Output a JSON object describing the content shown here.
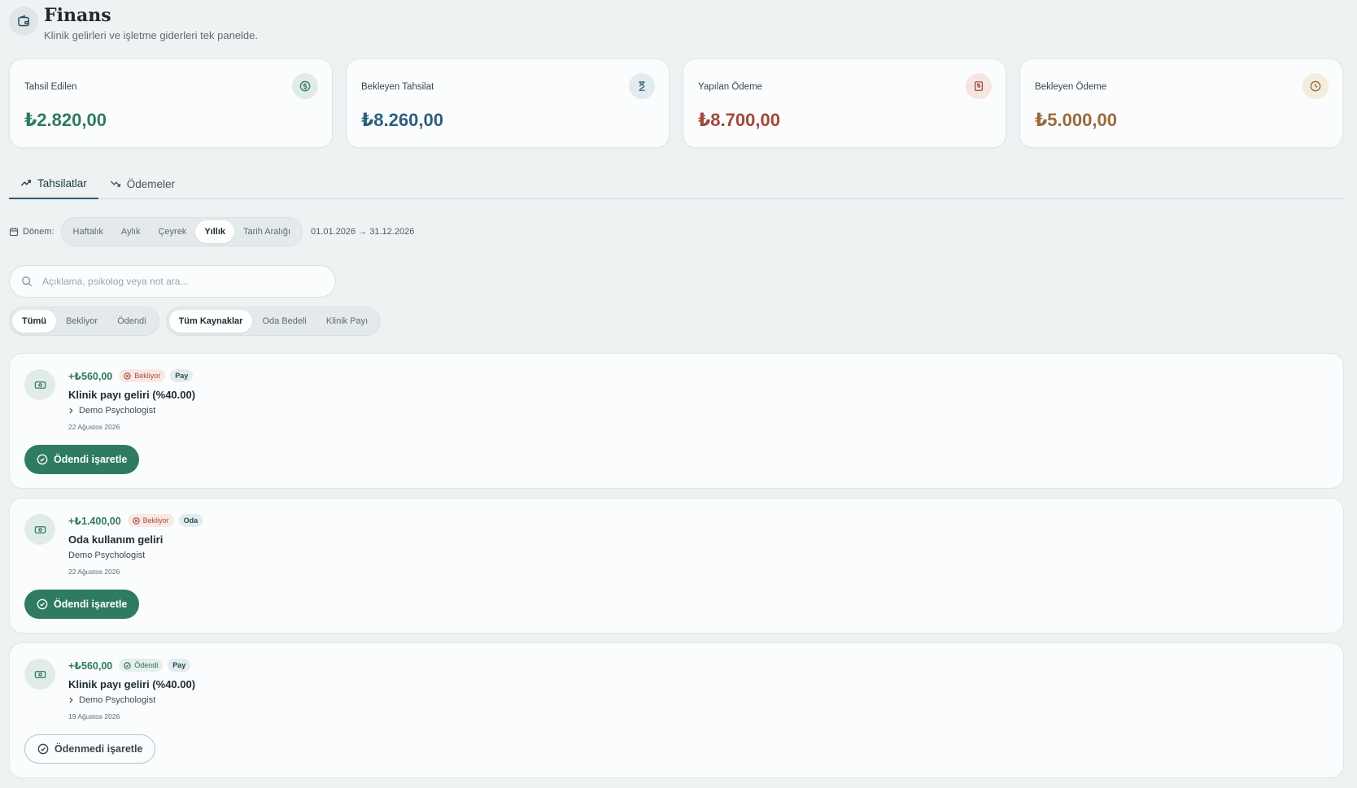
{
  "header": {
    "title": "Finans",
    "subtitle": "Klinik gelirleri ve işletme giderleri tek panelde.",
    "icon": "wallet-icon"
  },
  "stats": [
    {
      "label": "Tahsil Edilen",
      "value": "₺2.820,00",
      "color": "#2e7a62",
      "icon": "dollar-circle-icon",
      "icon_bg": "#e2ece7"
    },
    {
      "label": "Bekleyen Tahsilat",
      "value": "₺8.260,00",
      "color": "#2d5f7c",
      "icon": "hourglass-icon",
      "icon_bg": "#e3ebef"
    },
    {
      "label": "Yapılan Ödeme",
      "value": "₺8.700,00",
      "color": "#a3473a",
      "icon": "receipt-icon",
      "icon_bg": "#f6e6e2"
    },
    {
      "label": "Bekleyen Ödeme",
      "value": "₺5.000,00",
      "color": "#9a6a3a",
      "icon": "clock-icon",
      "icon_bg": "#f5ece0"
    }
  ],
  "tabs": {
    "collections": "Tahsilatlar",
    "payments": "Ödemeler"
  },
  "period": {
    "label": "Dönem:",
    "options": [
      "Haftalık",
      "Aylık",
      "Çeyrek",
      "Yıllık",
      "Tarih Aralığı"
    ],
    "selected": "Yıllık",
    "range": "01.01.2026 → 31.12.2026"
  },
  "search": {
    "placeholder": "Açıklama, psikolog veya not ara..."
  },
  "status_filter": {
    "options": [
      "Tümü",
      "Bekliyor",
      "Ödendi"
    ],
    "selected": "Tümü"
  },
  "source_filter": {
    "options": [
      "Tüm Kaynaklar",
      "Oda Bedeli",
      "Klinik Payı"
    ],
    "selected": "Tüm Kaynaklar"
  },
  "entries": [
    {
      "amount": "+₺560,00",
      "status": "Bekliyor",
      "source": "Pay",
      "title": "Klinik payı geliri (%40.00)",
      "person": "Demo Psychologist",
      "date": "22 Ağustos 2026",
      "action": "Ödendi işaretle"
    },
    {
      "amount": "+₺1.400,00",
      "status": "Bekliyor",
      "source": "Oda",
      "title": "Oda kullanım geliri",
      "person": "Demo Psychologist",
      "date": "22 Ağustos 2026",
      "action": "Ödendi işaretle"
    },
    {
      "amount": "+₺560,00",
      "status": "Ödendi",
      "source": "Pay",
      "title": "Klinik payı geliri (%40.00)",
      "person": "Demo Psychologist",
      "date": "19 Ağustos 2026",
      "action": "Ödenmedi işaretle"
    }
  ]
}
